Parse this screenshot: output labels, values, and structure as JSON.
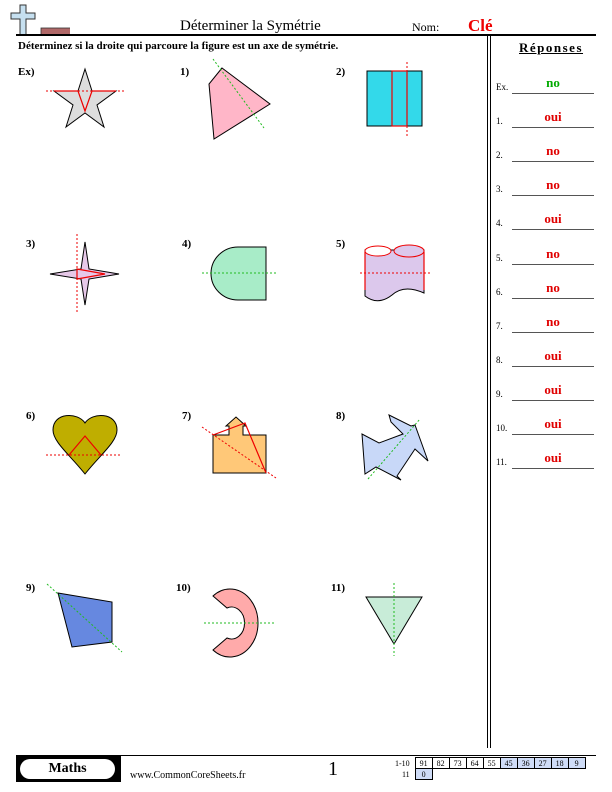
{
  "header": {
    "title": "Déterminer la Symétrie",
    "name_label": "Nom:",
    "name_value": "Clé",
    "instructions": "Déterminez si la droite qui parcoure la figure est un axe de symétrie."
  },
  "answers": {
    "title": "Réponses",
    "items": [
      {
        "label": "Ex.",
        "value": "no",
        "color": "#00aa00"
      },
      {
        "label": "1.",
        "value": "oui",
        "color": "#e00000"
      },
      {
        "label": "2.",
        "value": "no",
        "color": "#e00000"
      },
      {
        "label": "3.",
        "value": "no",
        "color": "#e00000"
      },
      {
        "label": "4.",
        "value": "oui",
        "color": "#e00000"
      },
      {
        "label": "5.",
        "value": "no",
        "color": "#e00000"
      },
      {
        "label": "6.",
        "value": "no",
        "color": "#e00000"
      },
      {
        "label": "7.",
        "value": "no",
        "color": "#e00000"
      },
      {
        "label": "8.",
        "value": "oui",
        "color": "#e00000"
      },
      {
        "label": "9.",
        "value": "oui",
        "color": "#e00000"
      },
      {
        "label": "10.",
        "value": "oui",
        "color": "#e00000"
      },
      {
        "label": "11.",
        "value": "oui",
        "color": "#e00000"
      }
    ]
  },
  "questions": [
    {
      "label": "Ex)",
      "shape": "star",
      "fill": "#dddddd",
      "axis_color": "#e00000"
    },
    {
      "label": "1)",
      "shape": "trapezoid",
      "fill": "#ffb6c8",
      "axis_color": "#22bb22"
    },
    {
      "label": "2)",
      "shape": "rectangle",
      "fill": "#33d9ea",
      "axis_color": "#e00000"
    },
    {
      "label": "3)",
      "shape": "four-point-star",
      "fill": "#e6c8e8",
      "axis_color": "#e00000"
    },
    {
      "label": "4)",
      "shape": "d-shape",
      "fill": "#a8ecc8",
      "axis_color": "#22bb22"
    },
    {
      "label": "5)",
      "shape": "cylinders",
      "fill": "#dcc8ec",
      "axis_color": "#e00000"
    },
    {
      "label": "6)",
      "shape": "heart",
      "fill": "#bfae00",
      "axis_color": "#e00000"
    },
    {
      "label": "7)",
      "shape": "house-arrow",
      "fill": "#ffc878",
      "axis_color": "#e00000"
    },
    {
      "label": "8)",
      "shape": "pinwheel",
      "fill": "#c8d8f8",
      "axis_color": "#22bb22"
    },
    {
      "label": "9)",
      "shape": "kite",
      "fill": "#6688e0",
      "axis_color": "#22bb22"
    },
    {
      "label": "10)",
      "shape": "c-ring",
      "fill": "#ffaaaa",
      "axis_color": "#22bb22"
    },
    {
      "label": "11)",
      "shape": "triangle",
      "fill": "#c8ecd8",
      "axis_color": "#22bb22"
    }
  ],
  "footer": {
    "brand": "Maths",
    "site": "www.CommonCoreSheets.fr",
    "page": "1",
    "score_rows": [
      {
        "label": "1-10",
        "cells": [
          "91",
          "82",
          "73",
          "64",
          "55",
          "45",
          "36",
          "27",
          "18",
          "9"
        ]
      },
      {
        "label": "11",
        "cells": [
          "0"
        ]
      }
    ]
  }
}
